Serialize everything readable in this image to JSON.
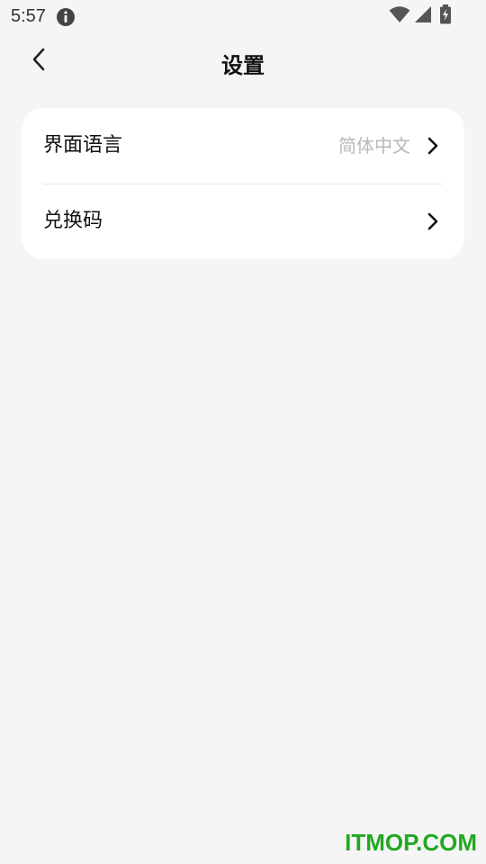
{
  "status_bar": {
    "time": "5:57",
    "icons": [
      "info-icon",
      "wifi-icon",
      "signal-icon",
      "battery-charging-icon"
    ]
  },
  "header": {
    "title": "设置",
    "back_icon": "chevron-left-icon"
  },
  "settings": {
    "items": [
      {
        "label": "界面语言",
        "value": "简体中文",
        "icon": "chevron-right-icon"
      },
      {
        "label": "兑换码",
        "value": "",
        "icon": "chevron-right-icon"
      }
    ]
  },
  "watermark": {
    "text": "ITMOP.COM",
    "color": "#22a822"
  },
  "colors": {
    "background": "#f5f5f5",
    "card": "#ffffff",
    "primary_text": "#111111",
    "secondary_text": "#b8b8b8"
  }
}
